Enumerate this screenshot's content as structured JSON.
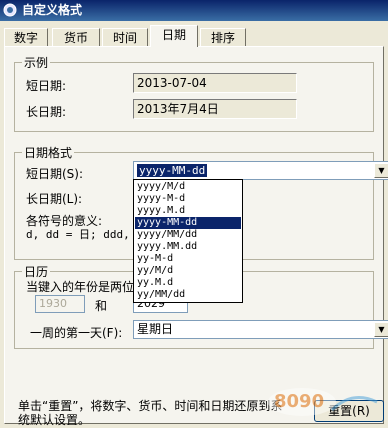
{
  "window": {
    "title": "自定义格式"
  },
  "tabs": [
    {
      "label": "数字"
    },
    {
      "label": "货币"
    },
    {
      "label": "时间"
    },
    {
      "label": "日期"
    },
    {
      "label": "排序"
    }
  ],
  "sample": {
    "group_title": "示例",
    "short_label": "短日期:",
    "short_value": "2013-07-04",
    "long_label": "长日期:",
    "long_value": "2013年7月4日"
  },
  "date_format": {
    "group_title": "日期格式",
    "short_label": "短日期(S):",
    "short_value": "yyyy-MM-dd",
    "long_label": "长日期(L):",
    "symbols_label": "各符号的意义:",
    "symbols_text": "d, dd = 日;  ddd,",
    "dropdown_items": [
      "yyyy/M/d",
      "yyyy-M-d",
      "yyyy.M.d",
      "yyyy-MM-dd",
      "yyyy/MM/dd",
      "yyyy.MM.dd",
      "yy-M-d",
      "yy/M/d",
      "yy.M.d",
      "yy/MM/dd"
    ],
    "selected_index": 3
  },
  "calendar": {
    "group_title": "日历",
    "two_digit_label": "当键入的年份是两位",
    "from_year": "1930",
    "and_label": "和",
    "to_year": "2029",
    "first_day_label": "一周的第一天(F):",
    "first_day_value": "星期日"
  },
  "footer": {
    "note_line1": "单击“重置”，将数字、货币、时间和日期还原到系",
    "note_line2": "统默认设置。",
    "reset_button": "重置(R)"
  }
}
